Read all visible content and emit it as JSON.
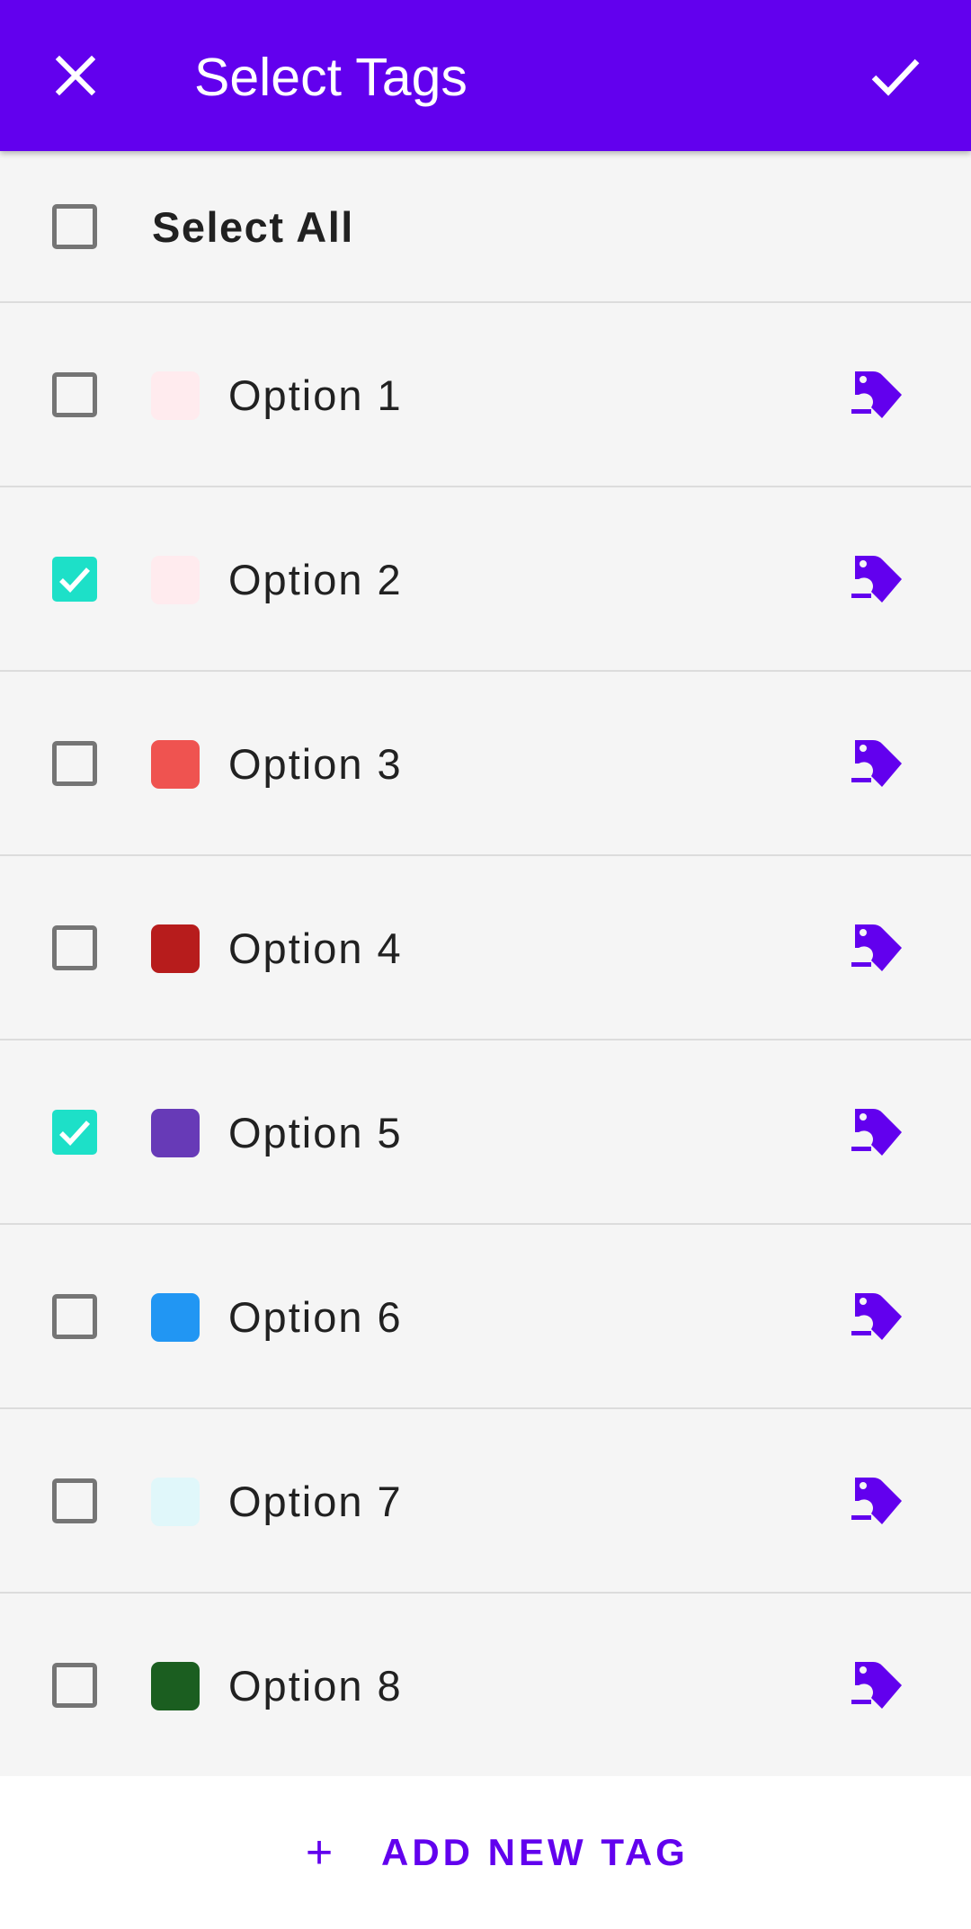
{
  "header": {
    "title": "Select Tags",
    "close_icon": "close-icon",
    "confirm_icon": "check-icon",
    "background": "#6200ee"
  },
  "select_all": {
    "label": "Select All",
    "checked": false
  },
  "tags": [
    {
      "label": "Option 1",
      "color": "#ffebee",
      "checked": false
    },
    {
      "label": "Option 2",
      "color": "#ffebee",
      "checked": true
    },
    {
      "label": "Option 3",
      "color": "#ef5350",
      "checked": false
    },
    {
      "label": "Option 4",
      "color": "#b71c1c",
      "checked": false
    },
    {
      "label": "Option 5",
      "color": "#673ab7",
      "checked": true
    },
    {
      "label": "Option 6",
      "color": "#2196f3",
      "checked": false
    },
    {
      "label": "Option 7",
      "color": "#e0f7fa",
      "checked": false
    },
    {
      "label": "Option 8",
      "color": "#1b5e20",
      "checked": false
    }
  ],
  "edit_icon": "tag-edit-icon",
  "footer": {
    "plus": "+",
    "label": "ADD NEW TAG",
    "color": "#6200ee"
  },
  "checkbox_checked_color": "#1de0c8"
}
